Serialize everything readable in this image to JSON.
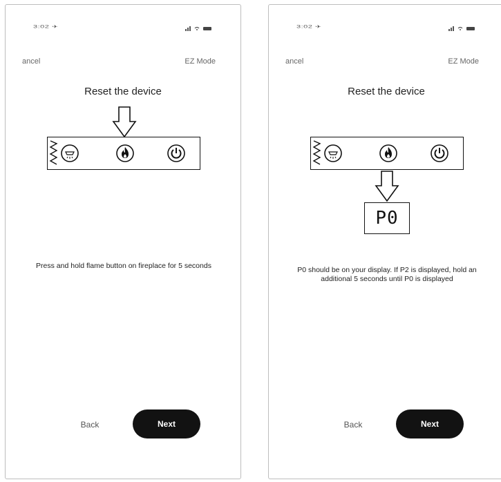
{
  "screens": [
    {
      "status_time": "3:02 ✈",
      "cancel_label": "ancel",
      "ez_mode_label": "EZ Mode",
      "title": "Reset the device",
      "instruction": "Press and hold flame button on fireplace for 5 seconds",
      "back_label": "Back",
      "next_label": "Next"
    },
    {
      "status_time": "3:02 ✈",
      "cancel_label": "ancel",
      "ez_mode_label": "EZ Mode",
      "title": "Reset the device",
      "display_value": "P0",
      "instruction": "P0 should be on your display. If P2 is displayed, hold an additional 5 seconds until P0 is displayed",
      "back_label": "Back",
      "next_label": "Next"
    }
  ],
  "icons": {
    "panel_buttons": [
      "light-icon",
      "flame-icon",
      "power-icon"
    ],
    "pointer": "down-arrow-icon"
  }
}
